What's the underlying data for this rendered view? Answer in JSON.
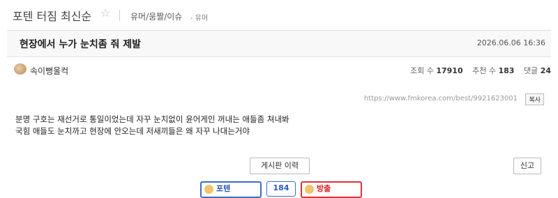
{
  "header": {
    "board_name": "포텐 터짐 최신순",
    "star": "☆",
    "category": "유머/움짤/이슈",
    "category_sub": "- 유머"
  },
  "post": {
    "title": "현장에서 누가 눈치좀 줘 제발",
    "date": "2026.06.06 16:36",
    "author": "속이뻥울컥",
    "stats": {
      "views_label": "조회 수",
      "views": "17910",
      "recommend_label": "추천 수",
      "recommend": "183",
      "comments_label": "댓글",
      "comments": "24"
    },
    "url": "https://www.fmkorea.com/best/9921623001",
    "copy_label": "복사",
    "body_lines": [
      "분명 구호는 재선거로 통일이었는데 자꾸 눈치없이 윤어게인 꺼내는 애들좀 쳐내봐",
      "국힘 애들도 눈치까고 현장에 안오는데 저새끼들은 왜 자꾸 나대는거야"
    ]
  },
  "actions": {
    "history_label": "게시판 이력",
    "report_label": "신고"
  },
  "votes": {
    "up_label": "포텐",
    "count": "184",
    "down_label": "방출",
    "colors": {
      "up": "#2a5bbf",
      "down": "#d22"
    }
  }
}
